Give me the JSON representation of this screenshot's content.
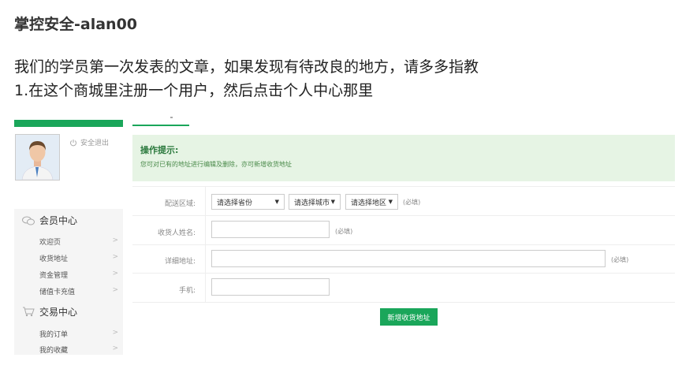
{
  "article": {
    "title": "掌控安全-alan00",
    "para1": "我们的学员第一次发表的文章，如果发现有待改良的地方，请多多指教",
    "para2": "1.在这个商城里注册一个用户，然后点击个人中心那里"
  },
  "sidebar": {
    "logout_label": "安全退出",
    "section1": "会员中心",
    "section1_items": [
      "欢迎页",
      "收货地址",
      "资金管理",
      "储值卡充值"
    ],
    "section2": "交易中心",
    "section2_items": [
      "我的订单",
      "我的收藏"
    ]
  },
  "tip": {
    "title": "操作提示:",
    "text": "您可对已有的地址进行编辑及删除，亦可新增收货地址"
  },
  "form": {
    "region_label": "配送区域:",
    "province": "请选择省份",
    "city": "请选择城市",
    "district": "请选择地区",
    "name_label": "收货人姓名:",
    "address_label": "详细地址:",
    "phone_label": "手机:",
    "required": "(必填)",
    "submit": "新增收货地址"
  },
  "colors": {
    "accent": "#1aa65a",
    "tip_bg": "#e6f4e4"
  }
}
